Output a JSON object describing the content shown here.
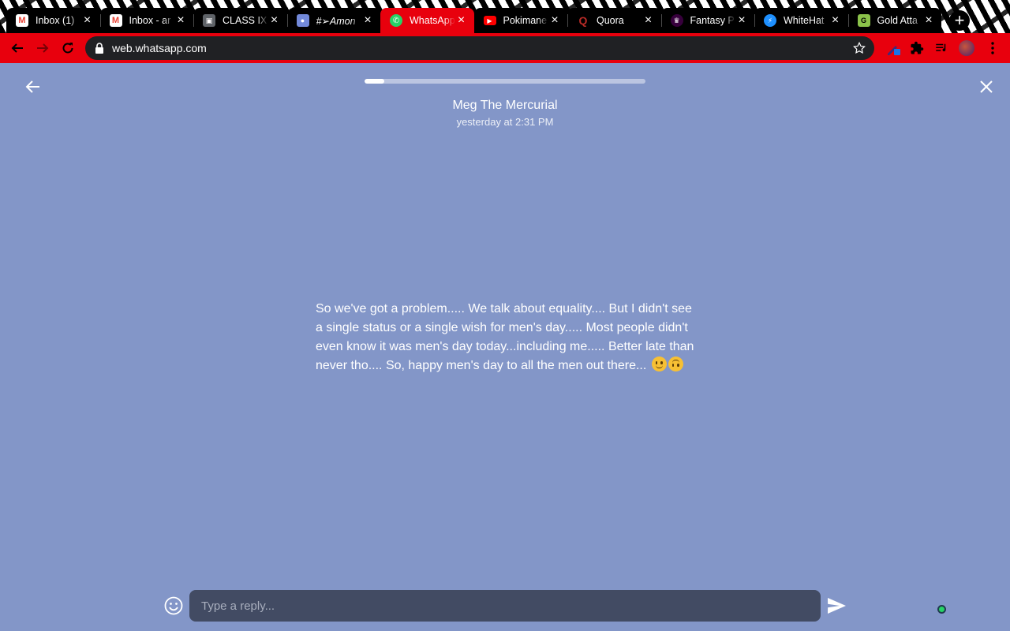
{
  "browser": {
    "tabs": [
      {
        "title": "Inbox (1)",
        "favicon": "gmail-icon",
        "active": false
      },
      {
        "title": "Inbox - ar",
        "favicon": "gmail-icon",
        "active": false
      },
      {
        "title": "CLASS IX",
        "favicon": "classroom-icon",
        "active": false
      },
      {
        "title": "#➢Amon",
        "favicon": "discord-icon",
        "active": false
      },
      {
        "title": "WhatsApp",
        "favicon": "whatsapp-icon",
        "active": true
      },
      {
        "title": "Pokimane",
        "favicon": "youtube-icon",
        "active": false
      },
      {
        "title": "Quora",
        "favicon": "quora-icon",
        "active": false
      },
      {
        "title": "Fantasy P",
        "favicon": "premier-league-icon",
        "active": false
      },
      {
        "title": "WhiteHat",
        "favicon": "whitehat-icon",
        "active": false
      },
      {
        "title": "Gold Atta",
        "favicon": "gold-attack-icon",
        "active": false
      }
    ],
    "url": "web.whatsapp.com",
    "colors": {
      "toolbar": "#e8000d",
      "omnibox": "#202124"
    }
  },
  "status": {
    "contact_name": "Meg The Mercurial",
    "timestamp": "yesterday at 2:31 PM",
    "progress": 0.07,
    "text": "So we've got a problem..... We talk about equality.... But I didn't see a single status or a single wish for men's day..... Most people didn't even know it was men's day today...including me..... Better late than never tho.... So, happy men's day to all the men out there...",
    "emojis": [
      "slightly-smiling-face",
      "upside-down-face"
    ],
    "background_color": "#8396c8"
  },
  "reply": {
    "placeholder": "Type a reply..."
  }
}
